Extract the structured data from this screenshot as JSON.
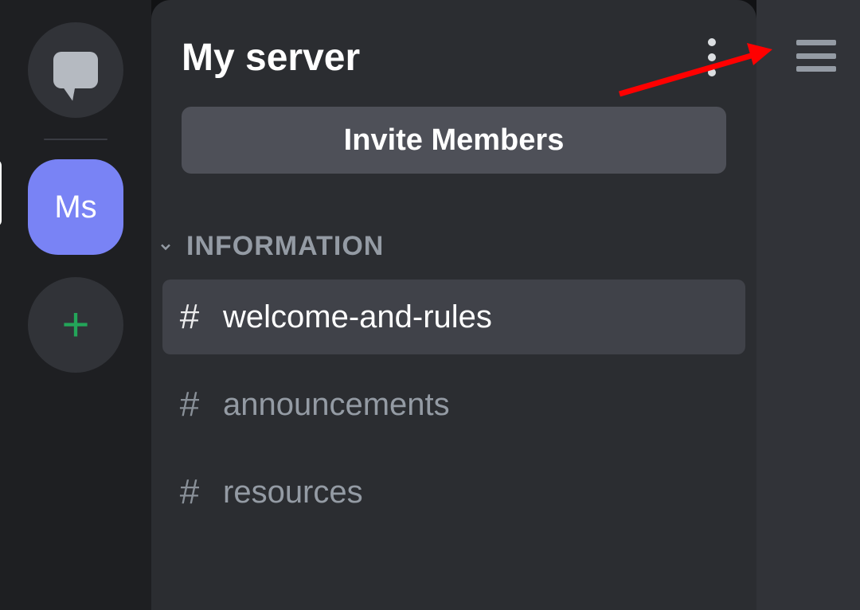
{
  "rail": {
    "server_label": "Ms"
  },
  "panel": {
    "title": "My server",
    "invite_label": "Invite Members",
    "category": "INFORMATION",
    "channels": [
      {
        "name": "welcome-and-rules",
        "active": true
      },
      {
        "name": "announcements",
        "active": false
      },
      {
        "name": "resources",
        "active": false
      }
    ]
  }
}
